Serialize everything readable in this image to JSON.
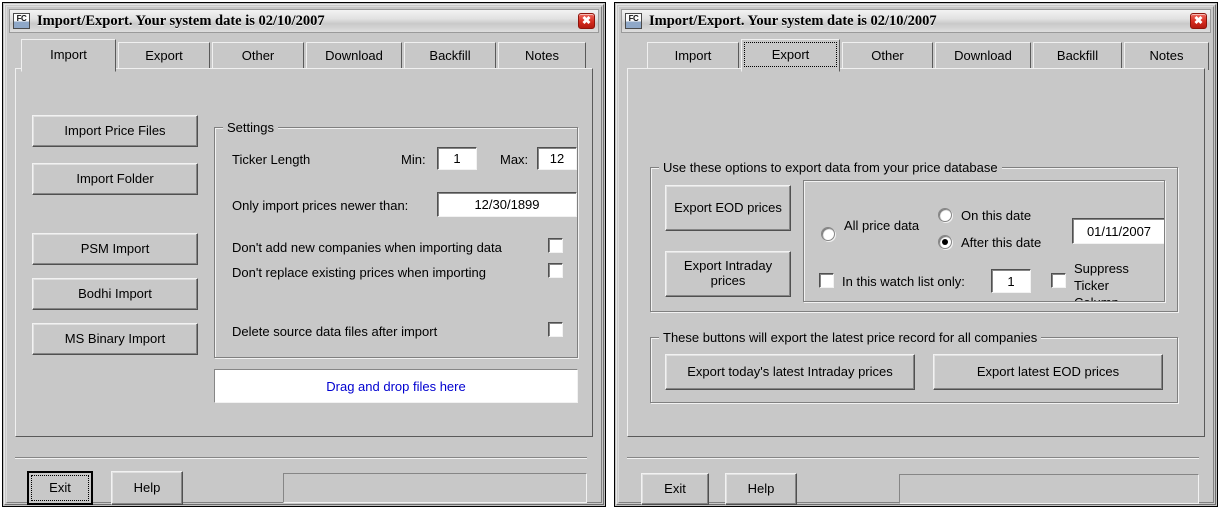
{
  "windows": [
    {
      "id": "left",
      "title": "Import/Export. Your system date is 02/10/2007",
      "app_icon": "FC",
      "close_label": "✖",
      "tabs": [
        {
          "label": "Import"
        },
        {
          "label": "Export"
        },
        {
          "label": "Other"
        },
        {
          "label": "Download"
        },
        {
          "label": "Backfill"
        },
        {
          "label": "Notes"
        }
      ],
      "selected_tab": "Import",
      "import_buttons": [
        {
          "label": "Import Price Files"
        },
        {
          "label": "Import Folder"
        },
        {
          "label": "PSM Import"
        },
        {
          "label": "Bodhi Import"
        },
        {
          "label": "MS Binary Import"
        }
      ],
      "settings": {
        "group_title": "Settings",
        "ticker_length_label": "Ticker Length",
        "min_label": "Min:",
        "min_value": "1",
        "max_label": "Max:",
        "max_value": "12",
        "newer_than_label": "Only import prices newer than:",
        "newer_than_value": "12/30/1899",
        "dont_add_label": "Don't add new companies when importing data",
        "dont_add_checked": false,
        "dont_replace_label": "Don't replace existing prices when importing",
        "dont_replace_checked": false,
        "delete_source_label": "Delete source data files after import",
        "delete_source_checked": false
      },
      "dropzone_label": "Drag and drop files here",
      "footer": {
        "exit_label": "Exit",
        "help_label": "Help",
        "exit_focused": true,
        "status_text": ""
      }
    },
    {
      "id": "right",
      "title": "Import/Export. Your system date is 02/10/2007",
      "app_icon": "FC",
      "close_label": "✖",
      "tabs": [
        {
          "label": "Import"
        },
        {
          "label": "Export"
        },
        {
          "label": "Other"
        },
        {
          "label": "Download"
        },
        {
          "label": "Backfill"
        },
        {
          "label": "Notes"
        }
      ],
      "selected_tab": "Export",
      "export_group": {
        "group_title": "Use these options to export data from your price database",
        "export_eod_label": "Export EOD prices",
        "export_intraday_label": "Export Intraday prices",
        "radio_all_label": "All price data",
        "radio_all_selected": false,
        "radio_on_date_label": "On this date",
        "radio_on_date_selected": false,
        "radio_after_date_label": "After this date",
        "radio_after_date_selected": true,
        "date_value": "01/11/2007",
        "watch_list_label": "In this watch list only:",
        "watch_list_checked": false,
        "watch_list_value": "1",
        "suppress_ticker_label": "Suppress Ticker Column",
        "suppress_ticker_checked": false
      },
      "latest_group": {
        "group_title": "These buttons will export the latest price record for all companies",
        "export_intraday_latest_label": "Export today's latest Intraday prices",
        "export_eod_latest_label": "Export latest EOD prices"
      },
      "footer": {
        "exit_label": "Exit",
        "help_label": "Help",
        "exit_focused": false,
        "status_text": ""
      }
    }
  ],
  "colors": {
    "face": "#c8c8c8",
    "titlebar_start": "#f3f3f3",
    "titlebar_end": "#c9c9c9",
    "close_red": "#d52b1e",
    "dropzone_text": "#0000d0",
    "text": "#000000"
  }
}
